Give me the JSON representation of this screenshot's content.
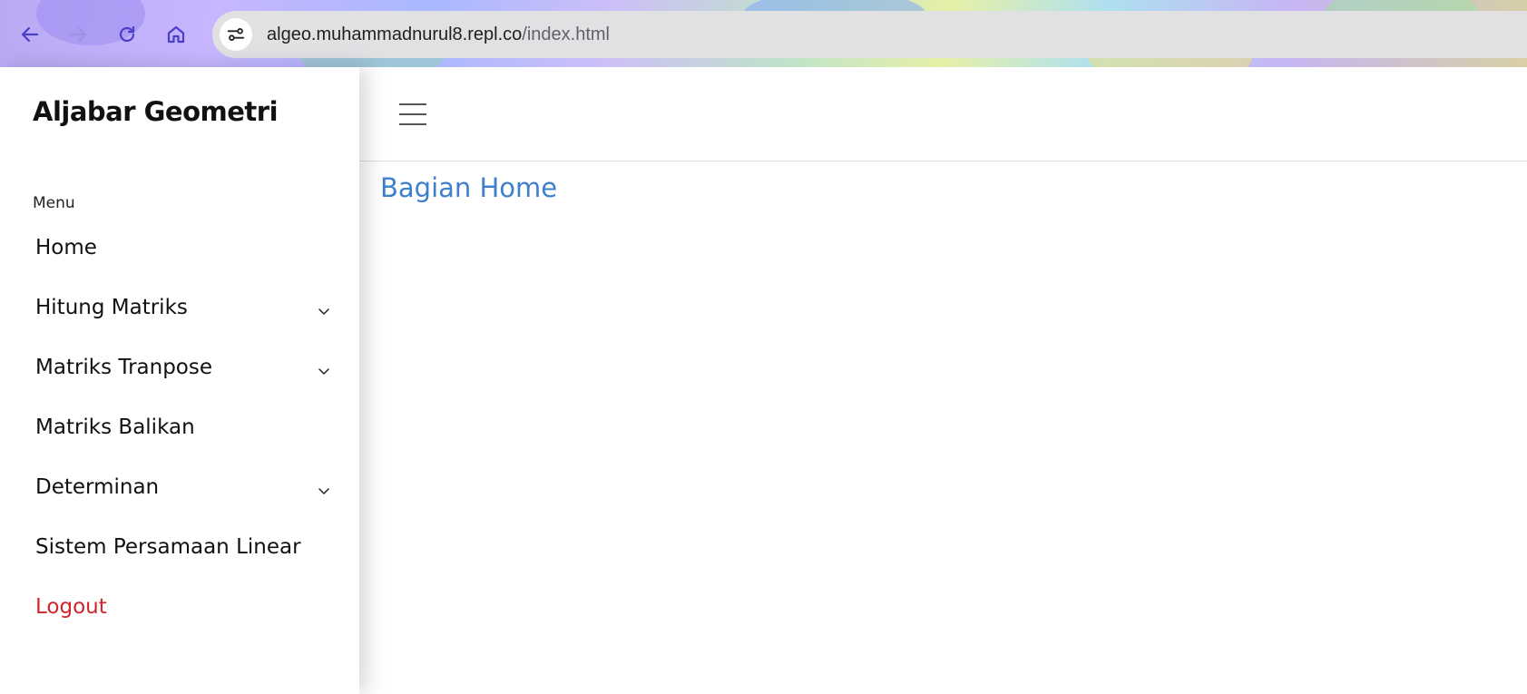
{
  "browser": {
    "url_host": "algeo.muhammadnurul8.repl.co",
    "url_path": "/index.html",
    "icons": [
      "back-icon",
      "forward-icon",
      "reload-icon",
      "home-icon",
      "site-info-icon"
    ]
  },
  "sidebar": {
    "brand": "Aljabar Geometri",
    "menu_heading": "Menu",
    "items": [
      {
        "label": "Home",
        "has_submenu": false
      },
      {
        "label": "Hitung Matriks",
        "has_submenu": true
      },
      {
        "label": "Matriks Tranpose",
        "has_submenu": true
      },
      {
        "label": "Matriks Balikan",
        "has_submenu": false
      },
      {
        "label": "Determinan",
        "has_submenu": true
      },
      {
        "label": "Sistem Persamaan Linear",
        "has_submenu": false
      },
      {
        "label": "Logout",
        "has_submenu": false
      }
    ]
  },
  "main": {
    "section_title": "Bagian Home",
    "toggle_icon": "hamburger-icon"
  },
  "colors": {
    "accent_title": "#3f7fcb",
    "logout": "#d0262b",
    "nav_icon": "#4b3fc7"
  }
}
